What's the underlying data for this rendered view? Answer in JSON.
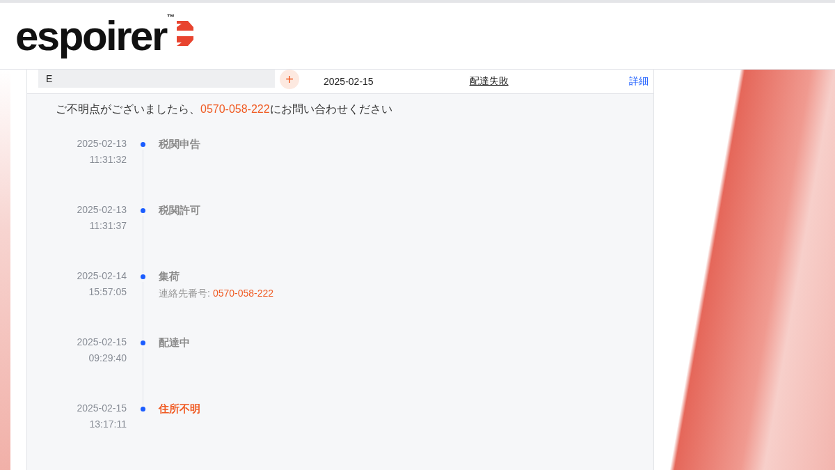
{
  "header": {
    "logo": "espoirer",
    "trademark": "™"
  },
  "shipment": {
    "tracking_field": "E",
    "add_button": "+",
    "date": "2025-02-15",
    "status": "配達失敗",
    "details_link": "詳細"
  },
  "notice": {
    "before": "ご不明点がございましたら、",
    "phone": "0570-058-222",
    "after": "にお問い合わせください"
  },
  "timeline": [
    {
      "date": "2025-02-13",
      "time": "11:31:32",
      "title": "税関申告",
      "alert": false
    },
    {
      "date": "2025-02-13",
      "time": "11:31:37",
      "title": "税関許可",
      "alert": false
    },
    {
      "date": "2025-02-14",
      "time": "15:57:05",
      "title": "集荷",
      "note_label": "連絡先番号:",
      "note_phone": "0570-058-222",
      "alert": false
    },
    {
      "date": "2025-02-15",
      "time": "09:29:40",
      "title": "配達中",
      "alert": false
    },
    {
      "date": "2025-02-15",
      "time": "13:17:11",
      "title": "住所不明",
      "alert": true
    }
  ]
}
